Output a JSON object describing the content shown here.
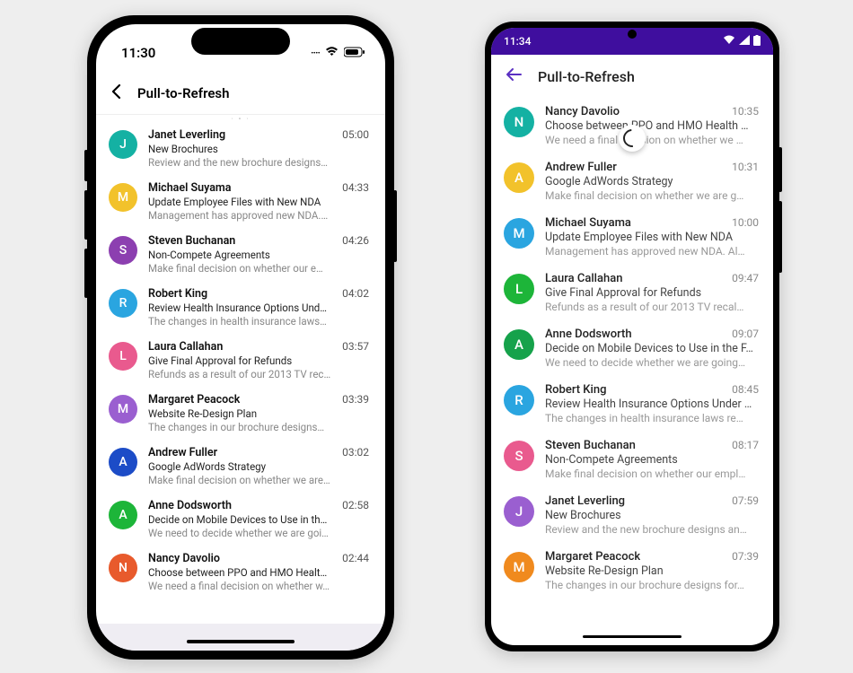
{
  "ios": {
    "status_time": "11:30",
    "header_title": "Pull-to-Refresh",
    "list": [
      {
        "initial": "J",
        "color": "#14b1a3",
        "name": "Janet Leverling",
        "subject": "New Brochures",
        "preview": "Review and the new brochure designs…",
        "time": "05:00"
      },
      {
        "initial": "M",
        "color": "#f2c22b",
        "name": "Michael Suyama",
        "subject": "Update Employee Files with New NDA",
        "preview": "Management has approved new NDA.…",
        "time": "04:33"
      },
      {
        "initial": "S",
        "color": "#8c3fb0",
        "name": "Steven Buchanan",
        "subject": "Non-Compete Agreements",
        "preview": "Make final decision on whether our e…",
        "time": "04:26"
      },
      {
        "initial": "R",
        "color": "#2aa5e0",
        "name": "Robert King",
        "subject": "Review Health Insurance Options Und…",
        "preview": "The changes in health insurance laws…",
        "time": "04:02"
      },
      {
        "initial": "L",
        "color": "#e95a8e",
        "name": "Laura Callahan",
        "subject": "Give Final Approval for Refunds",
        "preview": "Refunds as a result of our 2013 TV rec…",
        "time": "03:57"
      },
      {
        "initial": "M",
        "color": "#9a5fd0",
        "name": "Margaret Peacock",
        "subject": "Website Re-Design Plan",
        "preview": "The changes in our brochure designs…",
        "time": "03:39"
      },
      {
        "initial": "A",
        "color": "#1c4cc7",
        "name": "Andrew Fuller",
        "subject": "Google AdWords Strategy",
        "preview": "Make final decision on whether we are…",
        "time": "03:02"
      },
      {
        "initial": "A",
        "color": "#1db539",
        "name": "Anne Dodsworth",
        "subject": "Decide on Mobile Devices to Use in th…",
        "preview": "We need to decide whether we are goi…",
        "time": "02:58"
      },
      {
        "initial": "N",
        "color": "#e85a2c",
        "name": "Nancy Davolio",
        "subject": "Choose between PPO and HMO Healt…",
        "preview": "We need a final decision on whether w…",
        "time": "02:44"
      }
    ]
  },
  "android": {
    "status_time": "11:34",
    "header_title": "Pull-to-Refresh",
    "list": [
      {
        "initial": "N",
        "color": "#14b1a3",
        "name": "Nancy Davolio",
        "subject": "Choose between PPO and HMO Health …",
        "preview": "We need a final decision on whether we …",
        "time": "10:35"
      },
      {
        "initial": "A",
        "color": "#f2c22b",
        "name": "Andrew Fuller",
        "subject": "Google AdWords Strategy",
        "preview": "Make final decision on whether we are g…",
        "time": "10:31"
      },
      {
        "initial": "M",
        "color": "#2aa5e0",
        "name": "Michael Suyama",
        "subject": "Update Employee Files with New NDA",
        "preview": "Management has approved new NDA. Al…",
        "time": "10:00"
      },
      {
        "initial": "L",
        "color": "#1db539",
        "name": "Laura Callahan",
        "subject": "Give Final Approval for Refunds",
        "preview": "Refunds as a result of our 2013 TV recal…",
        "time": "09:47"
      },
      {
        "initial": "A",
        "color": "#16a24b",
        "name": "Anne Dodsworth",
        "subject": "Decide on Mobile Devices to Use in the F…",
        "preview": "We need to decide whether we are going…",
        "time": "09:07"
      },
      {
        "initial": "R",
        "color": "#2aa5e0",
        "name": "Robert King",
        "subject": "Review Health Insurance Options Under …",
        "preview": "The changes in health insurance laws re…",
        "time": "08:45"
      },
      {
        "initial": "S",
        "color": "#e95a8e",
        "name": "Steven Buchanan",
        "subject": "Non-Compete Agreements",
        "preview": "Make final decision on whether our empl…",
        "time": "08:17"
      },
      {
        "initial": "J",
        "color": "#9a5fd0",
        "name": "Janet Leverling",
        "subject": "New Brochures",
        "preview": "Review and the new brochure designs an…",
        "time": "07:59"
      },
      {
        "initial": "M",
        "color": "#f08a1e",
        "name": "Margaret Peacock",
        "subject": "Website Re-Design Plan",
        "preview": "The changes in our brochure designs for…",
        "time": "07:39"
      }
    ]
  }
}
